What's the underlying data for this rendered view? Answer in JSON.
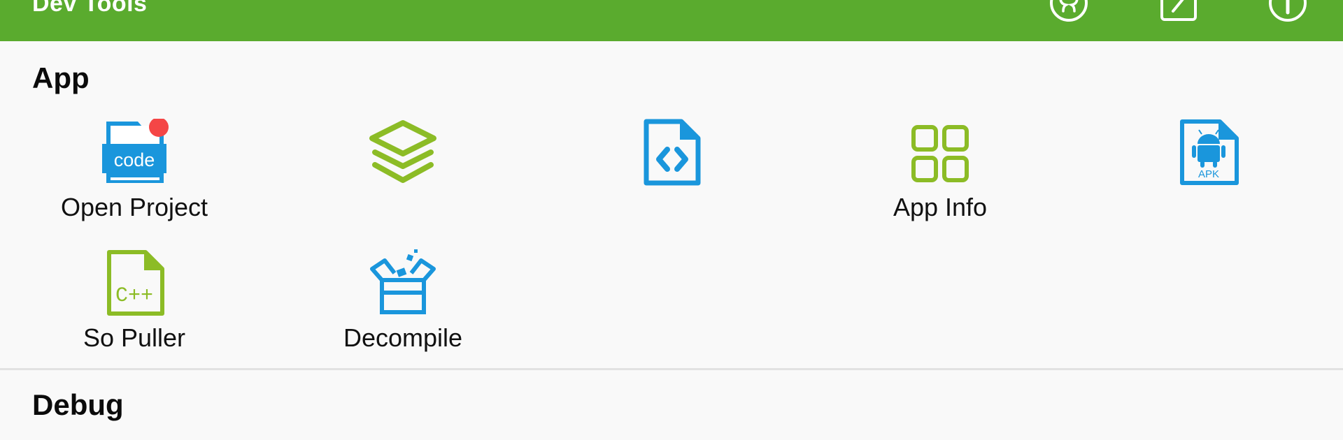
{
  "appbar": {
    "title": "Dev Tools",
    "color": "#5aab2e",
    "actions": [
      {
        "icon": "github-icon"
      },
      {
        "icon": "edit-icon"
      },
      {
        "icon": "info-icon"
      }
    ]
  },
  "sections": {
    "app": {
      "title": "App"
    },
    "debug": {
      "title": "Debug"
    }
  },
  "tools": [
    {
      "label": "Open Project",
      "icon": "code-folder-icon",
      "badge": true
    },
    {
      "label": "",
      "icon": "layers-icon"
    },
    {
      "label": "",
      "icon": "code-file-icon"
    },
    {
      "label": "App Info",
      "icon": "grid-icon"
    },
    {
      "label": "",
      "icon": "apk-file-icon"
    },
    {
      "label": "So Puller",
      "icon": "cpp-file-icon"
    },
    {
      "label": "Decompile",
      "icon": "open-box-icon"
    }
  ],
  "icon_texts": {
    "code": "code",
    "apk": "APK",
    "cpp": "C++"
  },
  "colors": {
    "blue": "#1a96dc",
    "green": "#8cbc26",
    "badge": "#f44646"
  }
}
